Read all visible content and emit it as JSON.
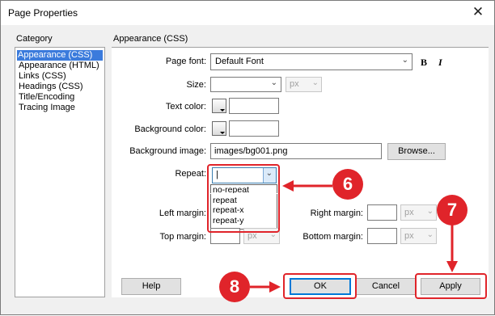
{
  "window": {
    "title": "Page Properties",
    "close_glyph": "✕"
  },
  "category": {
    "heading": "Category",
    "items": [
      "Appearance (CSS)",
      "Appearance (HTML)",
      "Links (CSS)",
      "Headings (CSS)",
      "Title/Encoding",
      "Tracing Image"
    ],
    "selected": "Appearance (CSS)"
  },
  "panel": {
    "heading": "Appearance (CSS)",
    "page_font": {
      "label": "Page font:",
      "value": "Default Font",
      "bold_label": "B",
      "italic_label": "I"
    },
    "size": {
      "label": "Size:",
      "value": "",
      "unit": "px"
    },
    "text_color": {
      "label": "Text color:",
      "value": ""
    },
    "background_color": {
      "label": "Background color:",
      "value": ""
    },
    "background_image": {
      "label": "Background image:",
      "value": "images/bg001.png",
      "browse_label": "Browse..."
    },
    "repeat": {
      "label": "Repeat:",
      "value": "",
      "options": [
        "no-repeat",
        "repeat",
        "repeat-x",
        "repeat-y"
      ]
    },
    "left_margin": {
      "label": "Left margin:",
      "unit": "px"
    },
    "right_margin": {
      "label": "Right margin:",
      "unit": "px"
    },
    "top_margin": {
      "label": "Top margin:",
      "unit": "px"
    },
    "bottom_margin": {
      "label": "Bottom margin:",
      "unit": "px"
    }
  },
  "buttons": {
    "help": "Help",
    "ok": "OK",
    "cancel": "Cancel",
    "apply": "Apply"
  },
  "annotations": {
    "step_6": "6",
    "step_7": "7",
    "step_8": "8",
    "color": "#e0242a"
  },
  "icons": {
    "dropdown": "chevron-down-icon",
    "close": "close-icon",
    "color_picker": "color-swatch-icon"
  }
}
